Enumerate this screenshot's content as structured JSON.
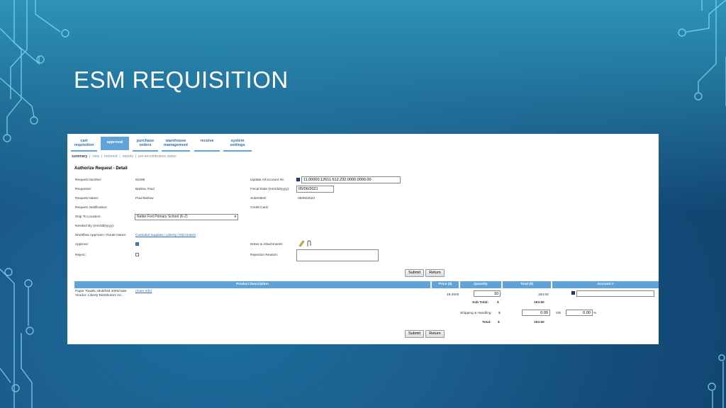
{
  "slide": {
    "title": "ESM REQUISITION"
  },
  "tabs": [
    {
      "line1": "cart",
      "line2": "requisition"
    },
    {
      "line1": "",
      "line2": "approval"
    },
    {
      "line1": "purchase",
      "line2": "orders"
    },
    {
      "line1": "warehouse",
      "line2": "management"
    },
    {
      "line1": "",
      "line2": "receive"
    },
    {
      "line1": "system",
      "line2": "settings"
    }
  ],
  "subnav": {
    "items": [
      "summary",
      "view",
      "returned",
      "reports",
      "pre-encumbrance status"
    ]
  },
  "detail": {
    "heading": "Authorize Request - Detail",
    "request_number_label": "Request Number:",
    "request_number": "62295",
    "requestor_label": "Requestor:",
    "requestor": "Barlow, Paul",
    "request_name_label": "Request Name:",
    "request_name": "Paul Barlow",
    "justification_label": "Request Justification:",
    "ship_to_label": "Ship To Location:",
    "ship_to": "Nutter Fort Primary School (K-2)",
    "needed_by_label": "Needed By (mm/dd/yyyy):",
    "workflow_label": "Workflow Approver / Route Name:",
    "workflow_link": "Custodial Supplies / Liberty / RD Orders",
    "approve_label": "Approve:",
    "reject_label": "Reject:",
    "update_account_label": "Update All Account #s:",
    "update_account_value": "11.00000.12611.612.232.0000.0000.00",
    "fiscal_date_label": "Fiscal Date (mm/dd/yyyy):",
    "fiscal_date_value": "05/06/2021",
    "submitted_label": "Submitted:",
    "submitted": "05/06/2023",
    "credit_card_label": "Credit Card:",
    "notes_label": "Notes & Attachments:",
    "rejection_label": "Rejection Reason:"
  },
  "buttons": {
    "submit": "Submit",
    "return": "Return"
  },
  "table": {
    "headers": [
      "Product Description",
      "Price ($)",
      "Quantity",
      "Total ($)",
      "Account #"
    ],
    "item_description": "Paper Towels, Multifold 4000/case",
    "item_vendor": "Vendor: Liberty Distributors Inc.",
    "more_info": "(more info)",
    "price": "19.2500",
    "quantity": "10",
    "total": "193.50",
    "subtotal_label": "Sub Total:",
    "currency": "$",
    "subtotal": "193.50",
    "shipping_label": "Shipping & Handling:",
    "shipping_value": "0.00",
    "or_label": "OR",
    "shipping_pct": "0.00",
    "pct_sign": "%",
    "total_label": "Total:",
    "grand_total": "193.50"
  }
}
